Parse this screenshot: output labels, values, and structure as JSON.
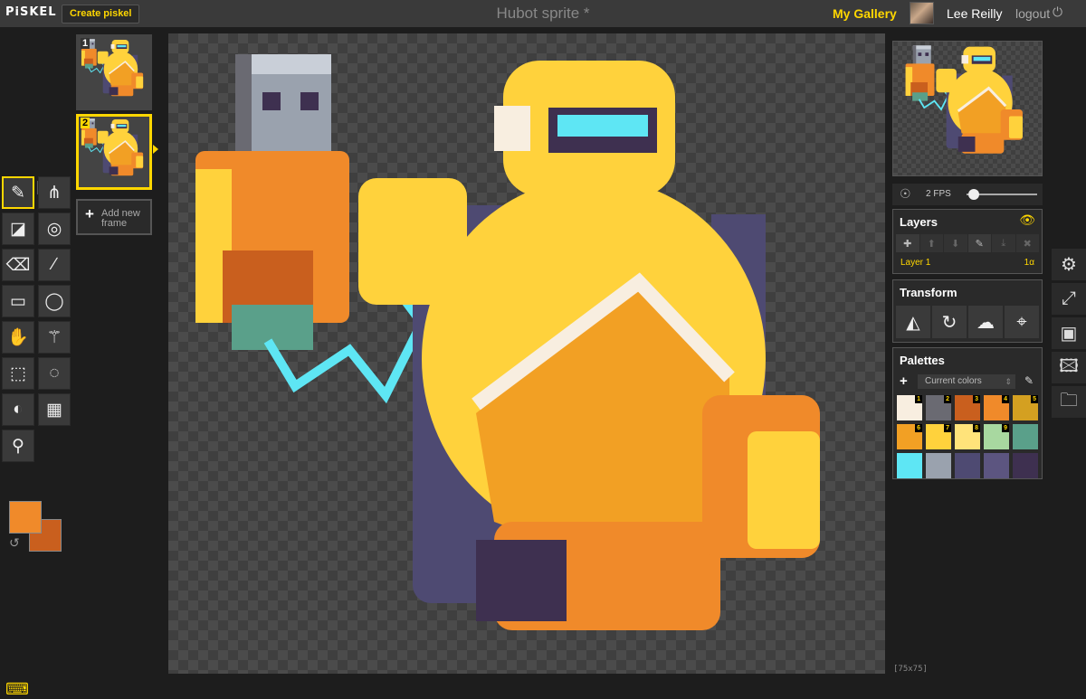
{
  "app": {
    "logo": "PiSKEL",
    "create_button": "Create piskel",
    "document_title": "Hubot sprite *",
    "gallery_link": "My Gallery",
    "user_name": "Lee Reilly",
    "logout_label": "logout"
  },
  "frames": {
    "items": [
      {
        "number": "1"
      },
      {
        "number": "2"
      }
    ],
    "add_label": "Add new frame"
  },
  "canvas": {
    "size_label": "[75x75]"
  },
  "preview": {
    "fps_label": "2 FPS"
  },
  "layers": {
    "title": "Layers",
    "items": [
      {
        "name": "Layer 1",
        "opacity": "1α"
      }
    ]
  },
  "transform": {
    "title": "Transform"
  },
  "palettes": {
    "title": "Palettes",
    "selected": "Current colors",
    "swatches": [
      {
        "number": "1",
        "color": "#f8eee0"
      },
      {
        "number": "2",
        "color": "#6a6a72"
      },
      {
        "number": "3",
        "color": "#c95f1e"
      },
      {
        "number": "4",
        "color": "#f08a2a"
      },
      {
        "number": "5",
        "color": "#d4a021"
      },
      {
        "number": "6",
        "color": "#f2a024"
      },
      {
        "number": "7",
        "color": "#ffd23c"
      },
      {
        "number": "8",
        "color": "#ffe37a"
      },
      {
        "number": "9",
        "color": "#a8d8a0"
      },
      {
        "number": "",
        "color": "#5aa08a"
      },
      {
        "number": "",
        "color": "#5ee6f4"
      },
      {
        "number": "",
        "color": "#9aa2ae"
      },
      {
        "number": "",
        "color": "#4e4a72"
      },
      {
        "number": "",
        "color": "#5c5580"
      },
      {
        "number": "",
        "color": "#3e3050"
      }
    ]
  },
  "colors": {
    "primary": "#f08a2a",
    "secondary": "#c95f1e",
    "accent": "#ffd700"
  },
  "icons": {
    "tools": [
      "pen-icon",
      "vertical-mirror-pen-icon",
      "paint-bucket-icon",
      "paint-all-icon",
      "eraser-icon",
      "stroke-icon",
      "rectangle-icon",
      "ellipse-icon",
      "move-icon",
      "magic-wand-icon",
      "rect-select-icon",
      "lasso-select-icon",
      "lighten-icon",
      "dithering-icon",
      "color-picker-icon"
    ],
    "sidebar": [
      "settings-icon",
      "resize-icon",
      "save-icon",
      "export-image-icon",
      "open-folder-icon"
    ]
  }
}
